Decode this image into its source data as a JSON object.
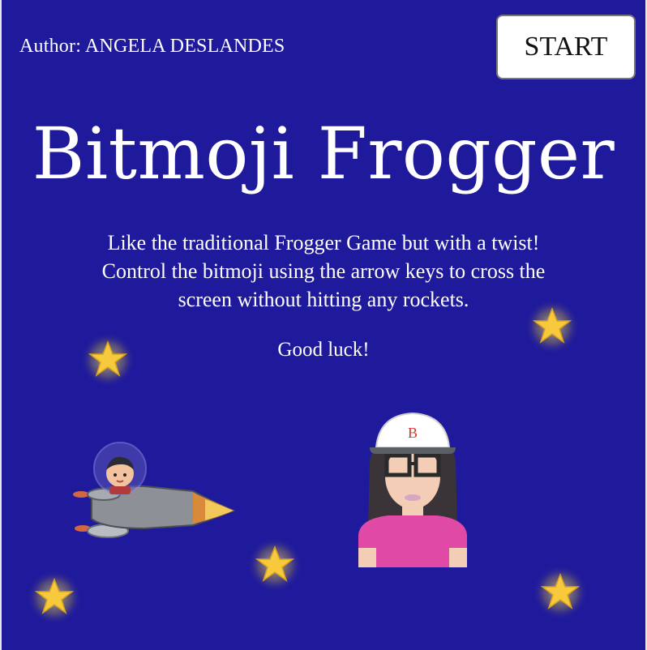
{
  "game": {
    "author": "Author: ANGELA DESLANDES",
    "start_label": "START",
    "title": "Bitmoji Frogger",
    "description_lines": [
      "Like the traditional Frogger Game but with a twist!",
      "Control the bitmoji using the arrow keys to cross the",
      "screen without hitting any rockets."
    ],
    "good_luck": "Good luck!",
    "cap_letter": "B"
  },
  "colors": {
    "background": "#1f1a9b",
    "star": "#f7c93c",
    "shirt": "#e04aa6",
    "cap_letter": "#d9342b"
  },
  "sprites": {
    "player": "bitmoji-girl-with-cap",
    "obstacle": "rocket-with-astronaut",
    "decor": "star-icon"
  }
}
